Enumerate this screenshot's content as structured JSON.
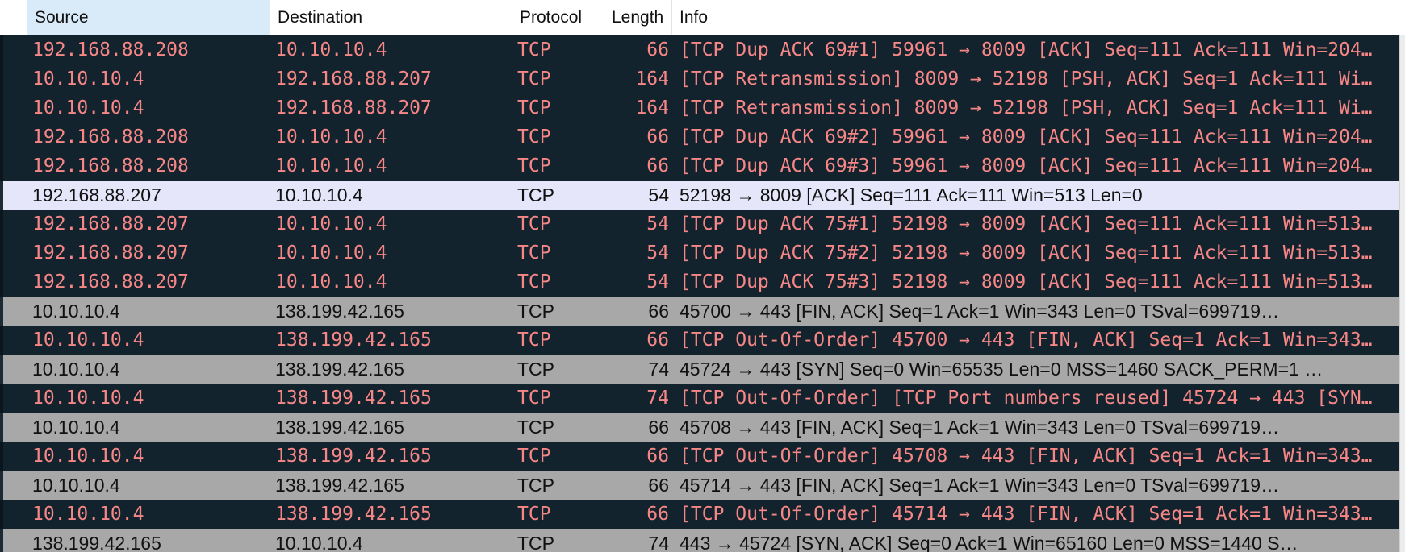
{
  "columns": {
    "source": "Source",
    "destination": "Destination",
    "protocol": "Protocol",
    "length": "Length",
    "info": "Info"
  },
  "colors": {
    "dark_row_bg": "#12232d",
    "dark_row_text": "#f78787",
    "grey_row_bg": "#a8a8a8",
    "selected_row_bg": "#e6e6fa",
    "sorted_header_bg": "#d9eaf8"
  },
  "rows": [
    {
      "style": "dark",
      "source": "192.168.88.208",
      "destination": "10.10.10.4",
      "protocol": "TCP",
      "length": "66",
      "info": "[TCP Dup ACK 69#1] 59961 → 8009 [ACK] Seq=111 Ack=111 Win=204…"
    },
    {
      "style": "dark",
      "source": "10.10.10.4",
      "destination": "192.168.88.207",
      "protocol": "TCP",
      "length": "164",
      "info": "[TCP Retransmission] 8009 → 52198 [PSH, ACK] Seq=1 Ack=111 Wi…"
    },
    {
      "style": "dark",
      "source": "10.10.10.4",
      "destination": "192.168.88.207",
      "protocol": "TCP",
      "length": "164",
      "info": "[TCP Retransmission] 8009 → 52198 [PSH, ACK] Seq=1 Ack=111 Wi…"
    },
    {
      "style": "dark",
      "source": "192.168.88.208",
      "destination": "10.10.10.4",
      "protocol": "TCP",
      "length": "66",
      "info": "[TCP Dup ACK 69#2] 59961 → 8009 [ACK] Seq=111 Ack=111 Win=204…"
    },
    {
      "style": "dark",
      "source": "192.168.88.208",
      "destination": "10.10.10.4",
      "protocol": "TCP",
      "length": "66",
      "info": "[TCP Dup ACK 69#3] 59961 → 8009 [ACK] Seq=111 Ack=111 Win=204…"
    },
    {
      "style": "selected",
      "source": "192.168.88.207",
      "destination": "10.10.10.4",
      "protocol": "TCP",
      "length": "54",
      "info": "52198 → 8009 [ACK] Seq=111 Ack=111 Win=513 Len=0"
    },
    {
      "style": "dark",
      "source": "192.168.88.207",
      "destination": "10.10.10.4",
      "protocol": "TCP",
      "length": "54",
      "info": "[TCP Dup ACK 75#1] 52198 → 8009 [ACK] Seq=111 Ack=111 Win=513…"
    },
    {
      "style": "dark",
      "source": "192.168.88.207",
      "destination": "10.10.10.4",
      "protocol": "TCP",
      "length": "54",
      "info": "[TCP Dup ACK 75#2] 52198 → 8009 [ACK] Seq=111 Ack=111 Win=513…"
    },
    {
      "style": "dark",
      "source": "192.168.88.207",
      "destination": "10.10.10.4",
      "protocol": "TCP",
      "length": "54",
      "info": "[TCP Dup ACK 75#3] 52198 → 8009 [ACK] Seq=111 Ack=111 Win=513…"
    },
    {
      "style": "grey",
      "source": "10.10.10.4",
      "destination": "138.199.42.165",
      "protocol": "TCP",
      "length": "66",
      "info": "45700 → 443 [FIN, ACK] Seq=1 Ack=1 Win=343 Len=0 TSval=699719…"
    },
    {
      "style": "dark",
      "source": "10.10.10.4",
      "destination": "138.199.42.165",
      "protocol": "TCP",
      "length": "66",
      "info": "[TCP Out-Of-Order] 45700 → 443 [FIN, ACK] Seq=1 Ack=1 Win=343…"
    },
    {
      "style": "grey",
      "source": "10.10.10.4",
      "destination": "138.199.42.165",
      "protocol": "TCP",
      "length": "74",
      "info": "45724 → 443 [SYN] Seq=0 Win=65535 Len=0 MSS=1460 SACK_PERM=1 …"
    },
    {
      "style": "dark",
      "source": "10.10.10.4",
      "destination": "138.199.42.165",
      "protocol": "TCP",
      "length": "74",
      "info": "[TCP Out-Of-Order] [TCP Port numbers reused] 45724 → 443 [SYN…"
    },
    {
      "style": "grey",
      "source": "10.10.10.4",
      "destination": "138.199.42.165",
      "protocol": "TCP",
      "length": "66",
      "info": "45708 → 443 [FIN, ACK] Seq=1 Ack=1 Win=343 Len=0 TSval=699719…"
    },
    {
      "style": "dark",
      "source": "10.10.10.4",
      "destination": "138.199.42.165",
      "protocol": "TCP",
      "length": "66",
      "info": "[TCP Out-Of-Order] 45708 → 443 [FIN, ACK] Seq=1 Ack=1 Win=343…"
    },
    {
      "style": "grey",
      "source": "10.10.10.4",
      "destination": "138.199.42.165",
      "protocol": "TCP",
      "length": "66",
      "info": "45714 → 443 [FIN, ACK] Seq=1 Ack=1 Win=343 Len=0 TSval=699719…"
    },
    {
      "style": "dark",
      "source": "10.10.10.4",
      "destination": "138.199.42.165",
      "protocol": "TCP",
      "length": "66",
      "info": "[TCP Out-Of-Order] 45714 → 443 [FIN, ACK] Seq=1 Ack=1 Win=343…"
    },
    {
      "style": "grey",
      "source": "138.199.42.165",
      "destination": "10.10.10.4",
      "protocol": "TCP",
      "length": "74",
      "info": "443 → 45724 [SYN, ACK] Seq=0 Ack=1 Win=65160 Len=0 MSS=1440 S…"
    }
  ]
}
